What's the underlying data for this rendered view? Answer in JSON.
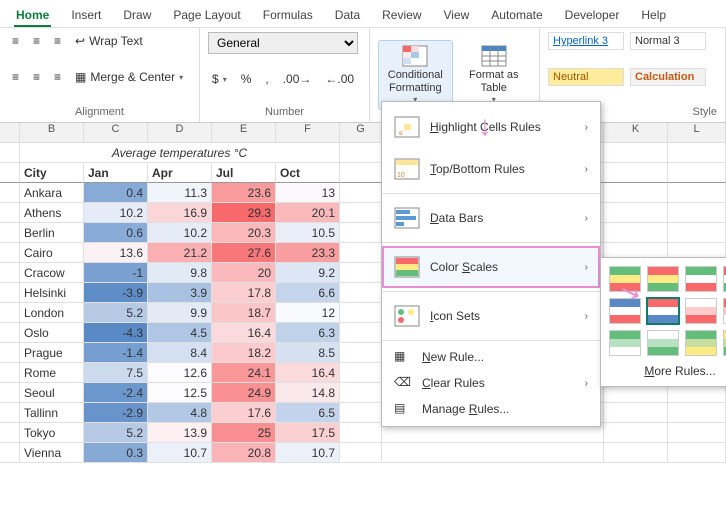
{
  "tabs": [
    "Home",
    "Insert",
    "Draw",
    "Page Layout",
    "Formulas",
    "Data",
    "Review",
    "View",
    "Automate",
    "Developer",
    "Help"
  ],
  "ribbon": {
    "alignment": {
      "wrap": "Wrap Text",
      "merge": "Merge & Center",
      "label": "Alignment"
    },
    "number": {
      "fmt": "General",
      "label": "Number"
    },
    "cf": {
      "cond": "Conditional Formatting",
      "table": "Format as Table"
    },
    "styles": {
      "hyperlink": "Hyperlink 3",
      "normal": "Normal 3",
      "neutral": "Neutral",
      "calc": "Calculation",
      "label": "Style"
    }
  },
  "menu": {
    "hcr": "Highlight Cells Rules",
    "tbr": "Top/Bottom Rules",
    "db": "Data Bars",
    "cs": "Color Scales",
    "is": "Icon Sets",
    "new": "New Rule...",
    "clear": "Clear Rules",
    "mgr": "Manage Rules...",
    "more": "More Rules..."
  },
  "sheet": {
    "cols": [
      "B",
      "C",
      "D",
      "E",
      "F",
      "G",
      "K",
      "L"
    ],
    "title": "Average temperatures °C",
    "headers": [
      "City",
      "Jan",
      "Apr",
      "Jul",
      "Oct"
    ],
    "rows": [
      {
        "city": "Ankara",
        "v": [
          0.4,
          11.3,
          23.6,
          13
        ]
      },
      {
        "city": "Athens",
        "v": [
          10.2,
          16.9,
          29.3,
          20.1
        ]
      },
      {
        "city": "Berlin",
        "v": [
          0.6,
          10.2,
          20.3,
          10.5
        ]
      },
      {
        "city": "Cairo",
        "v": [
          13.6,
          21.2,
          27.6,
          23.3
        ]
      },
      {
        "city": "Cracow",
        "v": [
          -1,
          9.8,
          20,
          9.2
        ]
      },
      {
        "city": "Helsinki",
        "v": [
          -3.9,
          3.9,
          17.8,
          6.6
        ]
      },
      {
        "city": "London",
        "v": [
          5.2,
          9.9,
          18.7,
          12
        ]
      },
      {
        "city": "Oslo",
        "v": [
          -4.3,
          4.5,
          16.4,
          6.3
        ]
      },
      {
        "city": "Prague",
        "v": [
          -1.4,
          8.4,
          18.2,
          8.5
        ]
      },
      {
        "city": "Rome",
        "v": [
          7.5,
          12.6,
          24.1,
          16.4
        ]
      },
      {
        "city": "Seoul",
        "v": [
          -2.4,
          12.5,
          24.9,
          14.8
        ]
      },
      {
        "city": "Tallinn",
        "v": [
          -2.9,
          4.8,
          17.6,
          6.5
        ]
      },
      {
        "city": "Tokyo",
        "v": [
          5.2,
          13.9,
          25,
          17.5
        ]
      },
      {
        "city": "Vienna",
        "v": [
          0.3,
          10.7,
          20.8,
          10.7
        ]
      }
    ]
  },
  "chart_data": {
    "type": "table",
    "title": "Average temperatures °C",
    "columns": [
      "City",
      "Jan",
      "Apr",
      "Jul",
      "Oct"
    ],
    "color_scale": {
      "min_color": "#5a8ac6",
      "mid_color": "#fcfcff",
      "max_color": "#f8696b",
      "applies_to": [
        "Jan",
        "Apr",
        "Jul",
        "Oct"
      ]
    },
    "rows": [
      [
        "Ankara",
        0.4,
        11.3,
        23.6,
        13
      ],
      [
        "Athens",
        10.2,
        16.9,
        29.3,
        20.1
      ],
      [
        "Berlin",
        0.6,
        10.2,
        20.3,
        10.5
      ],
      [
        "Cairo",
        13.6,
        21.2,
        27.6,
        23.3
      ],
      [
        "Cracow",
        -1,
        9.8,
        20,
        9.2
      ],
      [
        "Helsinki",
        -3.9,
        3.9,
        17.8,
        6.6
      ],
      [
        "London",
        5.2,
        9.9,
        18.7,
        12
      ],
      [
        "Oslo",
        -4.3,
        4.5,
        16.4,
        6.3
      ],
      [
        "Prague",
        -1.4,
        8.4,
        18.2,
        8.5
      ],
      [
        "Rome",
        7.5,
        12.6,
        24.1,
        16.4
      ],
      [
        "Seoul",
        -2.4,
        12.5,
        24.9,
        14.8
      ],
      [
        "Tallinn",
        -2.9,
        4.8,
        17.6,
        6.5
      ],
      [
        "Tokyo",
        5.2,
        13.9,
        25,
        17.5
      ],
      [
        "Vienna",
        0.3,
        10.7,
        20.8,
        10.7
      ]
    ]
  }
}
